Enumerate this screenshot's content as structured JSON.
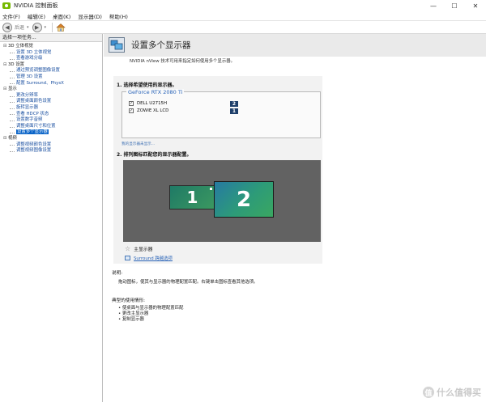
{
  "window": {
    "title": "NVIDIA 控制面板",
    "minimize": "—",
    "maximize": "☐",
    "close": "✕"
  },
  "menubar": [
    "文件(F)",
    "编辑(E)",
    "桌面(K)",
    "显示器(D)",
    "帮助(H)"
  ],
  "toolbar": {
    "back_label": "后退",
    "back_arrow": "◀",
    "forward_arrow": "▶",
    "dropdown": "▾"
  },
  "sidebar": {
    "title": "选择一项任务...",
    "categories": [
      {
        "label": "3D 立体视觉",
        "items": [
          "设置 3D 立体视觉",
          "查看游戏分级"
        ]
      },
      {
        "label": "3D 设置",
        "items": [
          "通过预览调整图像设置",
          "管理 3D 设置",
          "配置 Surround、PhysX"
        ]
      },
      {
        "label": "显示",
        "items": [
          "更改分辨率",
          "调整桌面颜色设置",
          "旋转显示器",
          "查看 HDCP 状态",
          "设置数字音频",
          "调整桌面尺寸和位置",
          "设置多个显示器"
        ]
      },
      {
        "label": "视频",
        "items": [
          "调整视频颜色设置",
          "调整视频图像设置"
        ]
      }
    ],
    "selected": "设置多个显示器"
  },
  "main": {
    "title": "设置多个显示器",
    "description": "NVIDIA nView 技术可用来指定如何使用多个显示器。",
    "step1": "1.  选择希望使用的显示器。",
    "gpu_name": "GeForce RTX 2080 Ti",
    "displays": [
      {
        "name": "DELL U2715H",
        "checked": true,
        "number": "2"
      },
      {
        "name": "ZOWIE XL LCD",
        "checked": true,
        "number": "1"
      }
    ],
    "more_link": "我的显示器未显示...",
    "step2": "2.  排列图标匹配您的显示器配置。",
    "monitor_1": "1",
    "monitor_2": "2",
    "primary_label": "主显示器",
    "surround_label": "Surround 跨越选项",
    "help_heading": "说明:",
    "help_text": "拖动图标，使其与显示器的物理配置匹配。右键单击图标查看其他选项。",
    "usage_heading": "典型的使用情形:",
    "usage_items": [
      "使桌面与显示器的物理配置匹配",
      "更改主显示器",
      "复制显示器"
    ]
  },
  "watermark": {
    "badge": "值",
    "text": "什么值得买"
  },
  "colors": {
    "nvidia_green": "#76b900",
    "selection_blue": "#0a64c8",
    "link_blue": "#2a64b8",
    "arrange_bg": "#626262"
  }
}
